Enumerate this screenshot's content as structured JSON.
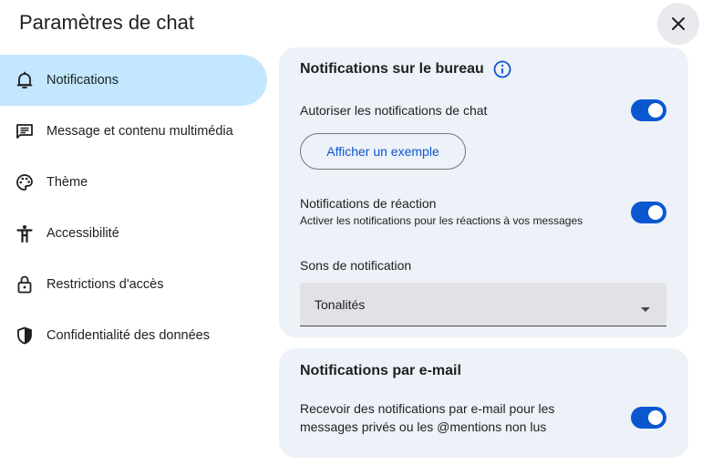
{
  "dialog": {
    "title": "Paramètres de chat"
  },
  "nav": {
    "items": [
      {
        "label": "Notifications",
        "icon": "bell-icon",
        "active": true
      },
      {
        "label": "Message et contenu multimédia",
        "icon": "message-list-icon",
        "active": false
      },
      {
        "label": "Thème",
        "icon": "palette-icon",
        "active": false
      },
      {
        "label": "Accessibilité",
        "icon": "accessibility-icon",
        "active": false
      },
      {
        "label": "Restrictions d'accès",
        "icon": "lock-icon",
        "active": false
      },
      {
        "label": "Confidentialité des données",
        "icon": "shield-icon",
        "active": false
      }
    ]
  },
  "desktop": {
    "title": "Notifications sur le bureau",
    "allow_label": "Autoriser les notifications de chat",
    "allow_on": true,
    "example_button": "Afficher un exemple",
    "reaction_label": "Notifications de réaction",
    "reaction_sub": "Activer les notifications pour les réactions à vos messages",
    "reaction_on": true,
    "sounds_label": "Sons de notification",
    "sounds_value": "Tonalités"
  },
  "email": {
    "title": "Notifications par e-mail",
    "receive_line1": "Recevoir des notifications par e-mail pour les",
    "receive_line2": "messages privés ou les @mentions non lus",
    "receive_on": true
  },
  "colors": {
    "accent": "#0b57d0",
    "active_nav": "#c2e7ff",
    "card_bg": "#edf1f8"
  }
}
